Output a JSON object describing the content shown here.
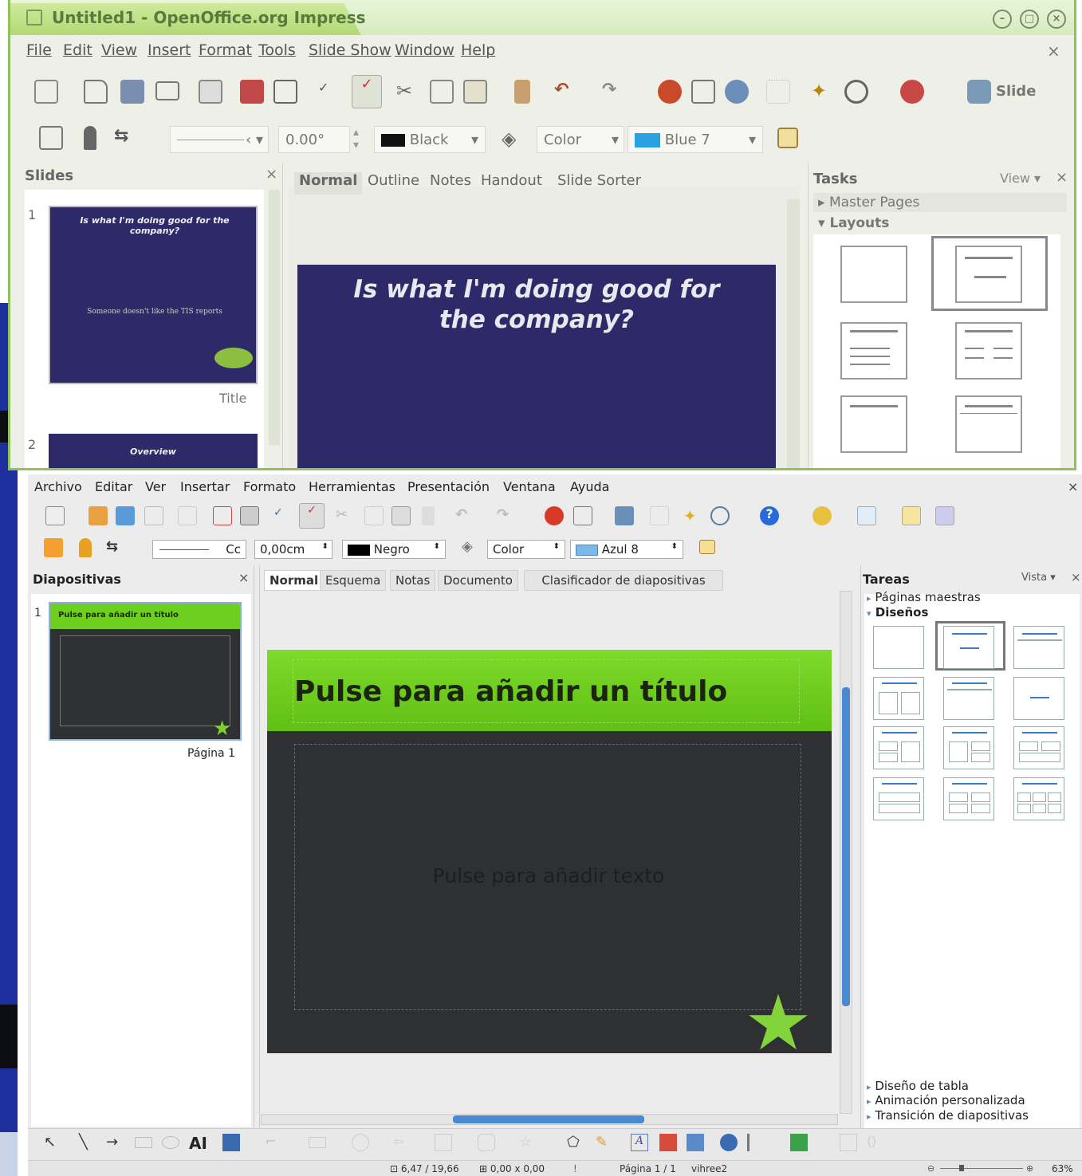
{
  "top_window": {
    "title": "Untitled1 - OpenOffice.org Impress",
    "menu": [
      "File",
      "Edit",
      "View",
      "Insert",
      "Format",
      "Tools",
      "Slide Show",
      "Window",
      "Help"
    ],
    "toolbar_slide_label": "Slide",
    "line_style_value": "",
    "angle_value": "0.00°",
    "line_color": "Black",
    "area_style": "Color",
    "area_color": "Blue 7",
    "slides_panel_title": "Slides",
    "slides": [
      {
        "number": "1",
        "title": "Is what I'm doing good for the company?",
        "subtitle": "Someone doesn't like the TIS reports",
        "caption": "Title"
      },
      {
        "number": "2",
        "title": "Overview"
      }
    ],
    "view_tabs": [
      "Normal",
      "Outline",
      "Notes",
      "Handout",
      "Slide Sorter"
    ],
    "slide_title": "Is what I'm doing good for the company?",
    "tasks_title": "Tasks",
    "tasks_view": "View",
    "task_sections": [
      "Master Pages",
      "Layouts"
    ]
  },
  "bottom_window": {
    "menu": [
      "Archivo",
      "Editar",
      "Ver",
      "Insertar",
      "Formato",
      "Herramientas",
      "Presentación",
      "Ventana",
      "Ayuda"
    ],
    "line_style_value": "Cc",
    "width_value": "0,00cm",
    "line_color": "Negro",
    "area_style": "Color",
    "area_color": "Azul 8",
    "slides_panel_title": "Diapositivas",
    "slides": [
      {
        "number": "1",
        "title": "Pulse para añadir un título",
        "caption": "Página 1"
      }
    ],
    "view_tabs": [
      "Normal",
      "Esquema",
      "Notas",
      "Documento",
      "Clasificador de diapositivas"
    ],
    "slide_title_placeholder": "Pulse para añadir un título",
    "slide_text_placeholder": "Pulse para añadir texto",
    "tasks_title": "Tareas",
    "tasks_view": "Vista",
    "task_sections_top": [
      "Páginas maestras",
      "Diseños"
    ],
    "task_sections_bottom": [
      "Diseño de tabla",
      "Animación personalizada",
      "Transición de diapositivas"
    ],
    "status": {
      "position": "6,47 / 19,66",
      "size": "0,00 x 0,00",
      "page": "Página 1 / 1",
      "master": "vihree2",
      "zoom": "63%"
    }
  },
  "colors": {
    "top_slide_bg": "#2e2a6a",
    "green_title_bar": "#6fcf1f",
    "dark_slide_bg": "#2e3032",
    "window_border": "#8fc25a"
  }
}
